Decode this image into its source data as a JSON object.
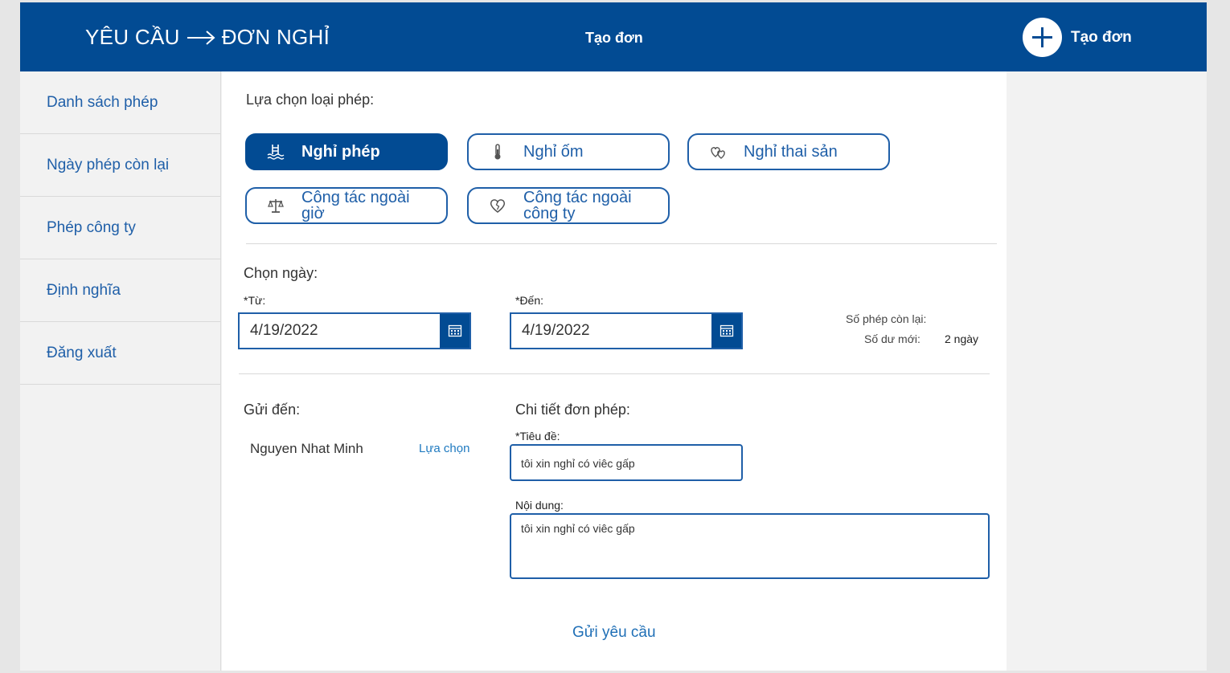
{
  "header": {
    "crumb_left": "YÊU CẦU",
    "crumb_right": "ĐƠN NGHỈ",
    "center_title": "Tạo đơn",
    "create_label": "Tạo đơn"
  },
  "sidebar": {
    "items": [
      {
        "label": "Danh sách phép"
      },
      {
        "label": "Ngày phép còn lại"
      },
      {
        "label": "Phép công ty"
      },
      {
        "label": "Định nghĩa"
      },
      {
        "label": "Đăng xuất"
      }
    ]
  },
  "leave_type": {
    "heading": "Lựa chọn loại phép:",
    "options": [
      {
        "label": "Nghỉ phép",
        "icon": "pool-icon",
        "selected": true
      },
      {
        "label": "Nghỉ ốm",
        "icon": "thermometer-icon",
        "selected": false
      },
      {
        "label": "Nghỉ thai sản",
        "icon": "hearts-icon",
        "selected": false
      },
      {
        "label_line1": "Công tác ngoài",
        "label_line2": "giờ",
        "icon": "scale-icon",
        "selected": false
      },
      {
        "label_line1": "Công tác ngoài",
        "label_line2": "công ty",
        "icon": "broken-heart-icon",
        "selected": false
      }
    ]
  },
  "dates": {
    "heading": "Chọn ngày:",
    "from_label": "*Từ:",
    "from_value": "4/19/2022",
    "to_label": "*Đến:",
    "to_value": "4/19/2022",
    "remaining_label": "Số phép còn lại:",
    "new_balance_label": "Số dư mới:",
    "new_balance_value": "2 ngày"
  },
  "send_to": {
    "heading": "Gửi đến:",
    "recipient": "Nguyen Nhat Minh",
    "choose_link": "Lựa chọn"
  },
  "details": {
    "heading": "Chi tiết đơn phép:",
    "title_label": "*Tiêu đề:",
    "title_value": "tôi xin nghỉ có viêc gấp",
    "content_label": "Nội dung:",
    "content_value": "tôi xin nghỉ có viêc gấp"
  },
  "submit_label": "Gửi yêu cầu",
  "colors": {
    "brand": "#024b93",
    "link": "#1f5fa8"
  }
}
